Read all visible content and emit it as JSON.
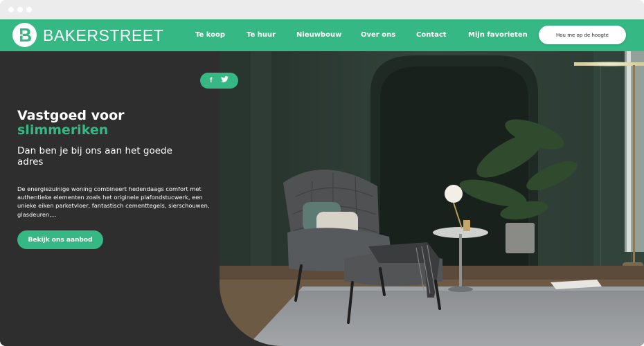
{
  "nav": {
    "logo_letter": "B",
    "logo_text": "BAKERSTREET",
    "links": [
      {
        "label": "Te koop"
      },
      {
        "label": "Te huur"
      },
      {
        "label": "Nieuwbouw"
      },
      {
        "label": "Over ons"
      },
      {
        "label": "Contact"
      },
      {
        "label": "Mijn favorieten"
      }
    ],
    "cta_label": "Hou me op de hoogte"
  },
  "social": {
    "facebook_glyph": "f",
    "twitter_icon": "twitter-icon"
  },
  "hero": {
    "title_line1": "Vastgoed voor",
    "title_line2": "slimmeriken",
    "subtitle": "Dan ben je bij ons aan het goede adres",
    "body": "De energiezuinige woning combineert hedendaags comfort met authentieke elementen zoals het originele plafondstucwerk, een unieke eiken parketvloer, fantastisch cementtegels, sierschouwen, glasdeuren,...",
    "button_label": "Bekijk ons aanbod"
  },
  "colors": {
    "brand_green": "#35b884",
    "dark_panel": "#2e2e2e"
  }
}
